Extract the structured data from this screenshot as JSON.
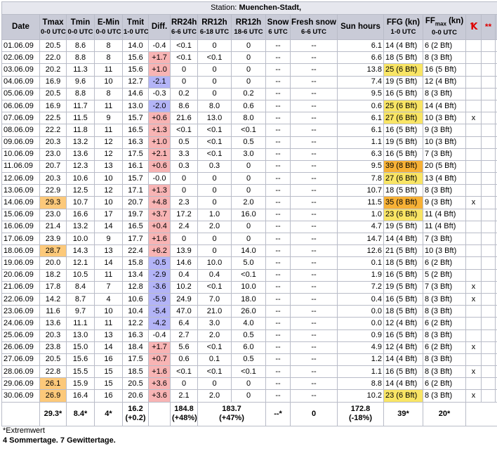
{
  "station_label": "Station:",
  "station_name": "Muenchen-Stadt,",
  "headers": {
    "date": "Date",
    "tmax": "Tmax",
    "tmax_sub": "0-0 UTC",
    "tmin": "Tmin",
    "tmin_sub": "0-0 UTC",
    "emin": "E-Min",
    "emin_sub": "0-0 UTC",
    "tmit": "Tmit",
    "tmit_sub": "1-0 UTC",
    "diff": "Diff.",
    "rr24": "RR24h",
    "rr24_sub": "6-6 UTC",
    "rr12a": "RR12h",
    "rr12a_sub": "6-18 UTC",
    "rr12b": "RR12h",
    "rr12b_sub": "18-6 UTC",
    "snow": "Snow",
    "snow_sub": "6 UTC",
    "fresh": "Fresh snow",
    "fresh_sub": "6-6 UTC",
    "sun": "Sun hours",
    "ffg": "FFG (kn)",
    "ffg_sub": "1-0 UTC",
    "ffmax": "FF",
    "ffmax_subscript": "max",
    "ffmax_unit": " (kn)",
    "ffmax_sub": "0-0 UTC",
    "sym1": "Ꝁ",
    "sym2": "**",
    "sym3": "∾"
  },
  "rows": [
    {
      "date": "01.06.09",
      "tmax": "20.5",
      "tmin": "8.6",
      "emin": "8",
      "tmit": "14.0",
      "diff": "-0.4",
      "rr24": "<0.1",
      "rr12a": "0",
      "rr12b": "0",
      "snow": "--",
      "fresh": "--",
      "sun": "6.1",
      "ffg": "14 (4 Bft)",
      "ffmax": "6 (2 Bft)",
      "x": ""
    },
    {
      "date": "02.06.09",
      "tmax": "22.0",
      "tmin": "8.8",
      "emin": "8",
      "tmit": "15.6",
      "diff": "+1.7",
      "rr24": "<0.1",
      "rr12a": "<0.1",
      "rr12b": "0",
      "snow": "--",
      "fresh": "--",
      "sun": "6.6",
      "ffg": "18 (5 Bft)",
      "ffmax": "8 (3 Bft)",
      "x": ""
    },
    {
      "date": "03.06.09",
      "tmax": "20.2",
      "tmin": "11.3",
      "emin": "11",
      "tmit": "15.6",
      "diff": "+1.0",
      "rr24": "0",
      "rr12a": "0",
      "rr12b": "0",
      "snow": "--",
      "fresh": "--",
      "sun": "13.8",
      "ffg": "25 (6 Bft)",
      "ffmax": "16 (5 Bft)",
      "x": ""
    },
    {
      "date": "04.06.09",
      "tmax": "16.9",
      "tmin": "9.6",
      "emin": "10",
      "tmit": "12.7",
      "diff": "-2.1",
      "rr24": "0",
      "rr12a": "0",
      "rr12b": "0",
      "snow": "--",
      "fresh": "--",
      "sun": "7.4",
      "ffg": "19 (5 Bft)",
      "ffmax": "12 (4 Bft)",
      "x": ""
    },
    {
      "date": "05.06.09",
      "tmax": "20.5",
      "tmin": "8.8",
      "emin": "8",
      "tmit": "14.6",
      "diff": "-0.3",
      "rr24": "0.2",
      "rr12a": "0",
      "rr12b": "0.2",
      "snow": "--",
      "fresh": "--",
      "sun": "9.5",
      "ffg": "16 (5 Bft)",
      "ffmax": "8 (3 Bft)",
      "x": ""
    },
    {
      "date": "06.06.09",
      "tmax": "16.9",
      "tmin": "11.7",
      "emin": "11",
      "tmit": "13.0",
      "diff": "-2.0",
      "rr24": "8.6",
      "rr12a": "8.0",
      "rr12b": "0.6",
      "snow": "--",
      "fresh": "--",
      "sun": "0.6",
      "ffg": "25 (6 Bft)",
      "ffmax": "14 (4 Bft)",
      "x": ""
    },
    {
      "date": "07.06.09",
      "tmax": "22.5",
      "tmin": "11.5",
      "emin": "9",
      "tmit": "15.7",
      "diff": "+0.6",
      "rr24": "21.6",
      "rr12a": "13.0",
      "rr12b": "8.0",
      "snow": "--",
      "fresh": "--",
      "sun": "6.1",
      "ffg": "27 (6 Bft)",
      "ffmax": "10 (3 Bft)",
      "x": "x"
    },
    {
      "date": "08.06.09",
      "tmax": "22.2",
      "tmin": "11.8",
      "emin": "11",
      "tmit": "16.5",
      "diff": "+1.3",
      "rr24": "<0.1",
      "rr12a": "<0.1",
      "rr12b": "<0.1",
      "snow": "--",
      "fresh": "--",
      "sun": "6.1",
      "ffg": "16 (5 Bft)",
      "ffmax": "9 (3 Bft)",
      "x": ""
    },
    {
      "date": "09.06.09",
      "tmax": "20.3",
      "tmin": "13.2",
      "emin": "12",
      "tmit": "16.3",
      "diff": "+1.0",
      "rr24": "0.5",
      "rr12a": "<0.1",
      "rr12b": "0.5",
      "snow": "--",
      "fresh": "--",
      "sun": "1.1",
      "ffg": "19 (5 Bft)",
      "ffmax": "10 (3 Bft)",
      "x": ""
    },
    {
      "date": "10.06.09",
      "tmax": "23.0",
      "tmin": "13.6",
      "emin": "12",
      "tmit": "17.5",
      "diff": "+2.1",
      "rr24": "3.3",
      "rr12a": "<0.1",
      "rr12b": "3.0",
      "snow": "--",
      "fresh": "--",
      "sun": "6.3",
      "ffg": "16 (5 Bft)",
      "ffmax": "7 (3 Bft)",
      "x": ""
    },
    {
      "date": "11.06.09",
      "tmax": "20.7",
      "tmin": "12.3",
      "emin": "13",
      "tmit": "16.1",
      "diff": "+0.6",
      "rr24": "0.3",
      "rr12a": "0.3",
      "rr12b": "0",
      "snow": "--",
      "fresh": "--",
      "sun": "9.5",
      "ffg": "39 (8 Bft)",
      "ffmax": "20 (5 Bft)",
      "x": ""
    },
    {
      "date": "12.06.09",
      "tmax": "20.3",
      "tmin": "10.6",
      "emin": "10",
      "tmit": "15.7",
      "diff": "-0.0",
      "rr24": "0",
      "rr12a": "0",
      "rr12b": "0",
      "snow": "--",
      "fresh": "--",
      "sun": "7.8",
      "ffg": "27 (6 Bft)",
      "ffmax": "13 (4 Bft)",
      "x": ""
    },
    {
      "date": "13.06.09",
      "tmax": "22.9",
      "tmin": "12.5",
      "emin": "12",
      "tmit": "17.1",
      "diff": "+1.3",
      "rr24": "0",
      "rr12a": "0",
      "rr12b": "0",
      "snow": "--",
      "fresh": "--",
      "sun": "10.7",
      "ffg": "18 (5 Bft)",
      "ffmax": "8 (3 Bft)",
      "x": ""
    },
    {
      "date": "14.06.09",
      "tmax": "29.3",
      "tmin": "10.7",
      "emin": "10",
      "tmit": "20.7",
      "diff": "+4.8",
      "rr24": "2.3",
      "rr12a": "0",
      "rr12b": "2.0",
      "snow": "--",
      "fresh": "--",
      "sun": "11.5",
      "ffg": "35 (8 Bft)",
      "ffmax": "9 (3 Bft)",
      "x": "x"
    },
    {
      "date": "15.06.09",
      "tmax": "23.0",
      "tmin": "16.6",
      "emin": "17",
      "tmit": "19.7",
      "diff": "+3.7",
      "rr24": "17.2",
      "rr12a": "1.0",
      "rr12b": "16.0",
      "snow": "--",
      "fresh": "--",
      "sun": "1.0",
      "ffg": "23 (6 Bft)",
      "ffmax": "11 (4 Bft)",
      "x": ""
    },
    {
      "date": "16.06.09",
      "tmax": "21.4",
      "tmin": "13.2",
      "emin": "14",
      "tmit": "16.5",
      "diff": "+0.4",
      "rr24": "2.4",
      "rr12a": "2.0",
      "rr12b": "0",
      "snow": "--",
      "fresh": "--",
      "sun": "4.7",
      "ffg": "19 (5 Bft)",
      "ffmax": "11 (4 Bft)",
      "x": ""
    },
    {
      "date": "17.06.09",
      "tmax": "23.9",
      "tmin": "10.0",
      "emin": "9",
      "tmit": "17.7",
      "diff": "+1.6",
      "rr24": "0",
      "rr12a": "0",
      "rr12b": "0",
      "snow": "--",
      "fresh": "--",
      "sun": "14.7",
      "ffg": "14 (4 Bft)",
      "ffmax": "7 (3 Bft)",
      "x": ""
    },
    {
      "date": "18.06.09",
      "tmax": "28.7",
      "tmin": "14.3",
      "emin": "13",
      "tmit": "22.4",
      "diff": "+6.2",
      "rr24": "13.9",
      "rr12a": "0",
      "rr12b": "14.0",
      "snow": "--",
      "fresh": "--",
      "sun": "12.6",
      "ffg": "21 (5 Bft)",
      "ffmax": "10 (3 Bft)",
      "x": ""
    },
    {
      "date": "19.06.09",
      "tmax": "20.0",
      "tmin": "12.1",
      "emin": "14",
      "tmit": "15.8",
      "diff": "-0.5",
      "rr24": "14.6",
      "rr12a": "10.0",
      "rr12b": "5.0",
      "snow": "--",
      "fresh": "--",
      "sun": "0.1",
      "ffg": "18 (5 Bft)",
      "ffmax": "6 (2 Bft)",
      "x": ""
    },
    {
      "date": "20.06.09",
      "tmax": "18.2",
      "tmin": "10.5",
      "emin": "11",
      "tmit": "13.4",
      "diff": "-2.9",
      "rr24": "0.4",
      "rr12a": "0.4",
      "rr12b": "<0.1",
      "snow": "--",
      "fresh": "--",
      "sun": "1.9",
      "ffg": "16 (5 Bft)",
      "ffmax": "5 (2 Bft)",
      "x": ""
    },
    {
      "date": "21.06.09",
      "tmax": "17.8",
      "tmin": "8.4",
      "emin": "7",
      "tmit": "12.8",
      "diff": "-3.6",
      "rr24": "10.2",
      "rr12a": "<0.1",
      "rr12b": "10.0",
      "snow": "--",
      "fresh": "--",
      "sun": "7.2",
      "ffg": "19 (5 Bft)",
      "ffmax": "7 (3 Bft)",
      "x": "x"
    },
    {
      "date": "22.06.09",
      "tmax": "14.2",
      "tmin": "8.7",
      "emin": "4",
      "tmit": "10.6",
      "diff": "-5.9",
      "rr24": "24.9",
      "rr12a": "7.0",
      "rr12b": "18.0",
      "snow": "--",
      "fresh": "--",
      "sun": "0.4",
      "ffg": "16 (5 Bft)",
      "ffmax": "8 (3 Bft)",
      "x": "x"
    },
    {
      "date": "23.06.09",
      "tmax": "11.6",
      "tmin": "9.7",
      "emin": "10",
      "tmit": "10.4",
      "diff": "-5.4",
      "rr24": "47.0",
      "rr12a": "21.0",
      "rr12b": "26.0",
      "snow": "--",
      "fresh": "--",
      "sun": "0.0",
      "ffg": "18 (5 Bft)",
      "ffmax": "8 (3 Bft)",
      "x": ""
    },
    {
      "date": "24.06.09",
      "tmax": "13.6",
      "tmin": "11.1",
      "emin": "11",
      "tmit": "12.2",
      "diff": "-4.2",
      "rr24": "6.4",
      "rr12a": "3.0",
      "rr12b": "4.0",
      "snow": "--",
      "fresh": "--",
      "sun": "0.0",
      "ffg": "12 (4 Bft)",
      "ffmax": "6 (2 Bft)",
      "x": ""
    },
    {
      "date": "25.06.09",
      "tmax": "20.3",
      "tmin": "13.0",
      "emin": "13",
      "tmit": "16.3",
      "diff": "-0.4",
      "rr24": "2.7",
      "rr12a": "2.0",
      "rr12b": "0.5",
      "snow": "--",
      "fresh": "--",
      "sun": "0.9",
      "ffg": "16 (5 Bft)",
      "ffmax": "8 (3 Bft)",
      "x": ""
    },
    {
      "date": "26.06.09",
      "tmax": "23.8",
      "tmin": "15.0",
      "emin": "14",
      "tmit": "18.4",
      "diff": "+1.7",
      "rr24": "5.6",
      "rr12a": "<0.1",
      "rr12b": "6.0",
      "snow": "--",
      "fresh": "--",
      "sun": "4.9",
      "ffg": "12 (4 Bft)",
      "ffmax": "6 (2 Bft)",
      "x": "x"
    },
    {
      "date": "27.06.09",
      "tmax": "20.5",
      "tmin": "15.6",
      "emin": "16",
      "tmit": "17.5",
      "diff": "+0.7",
      "rr24": "0.6",
      "rr12a": "0.1",
      "rr12b": "0.5",
      "snow": "--",
      "fresh": "--",
      "sun": "1.2",
      "ffg": "14 (4 Bft)",
      "ffmax": "8 (3 Bft)",
      "x": ""
    },
    {
      "date": "28.06.09",
      "tmax": "22.8",
      "tmin": "15.5",
      "emin": "15",
      "tmit": "18.5",
      "diff": "+1.6",
      "rr24": "<0.1",
      "rr12a": "<0.1",
      "rr12b": "<0.1",
      "snow": "--",
      "fresh": "--",
      "sun": "1.1",
      "ffg": "16 (5 Bft)",
      "ffmax": "8 (3 Bft)",
      "x": "x"
    },
    {
      "date": "29.06.09",
      "tmax": "26.1",
      "tmin": "15.9",
      "emin": "15",
      "tmit": "20.5",
      "diff": "+3.6",
      "rr24": "0",
      "rr12a": "0",
      "rr12b": "0",
      "snow": "--",
      "fresh": "--",
      "sun": "8.8",
      "ffg": "14 (4 Bft)",
      "ffmax": "6 (2 Bft)",
      "x": ""
    },
    {
      "date": "30.06.09",
      "tmax": "26.9",
      "tmin": "16.4",
      "emin": "16",
      "tmit": "20.6",
      "diff": "+3.6",
      "rr24": "2.1",
      "rr12a": "2.0",
      "rr12b": "0",
      "snow": "--",
      "fresh": "--",
      "sun": "10.2",
      "ffg": "23 (6 Bft)",
      "ffmax": "8 (3 Bft)",
      "x": "x"
    }
  ],
  "summary": {
    "tmax": "29.3*",
    "tmin": "8.4*",
    "emin": "4*",
    "tmit": "16.2",
    "tmit2": "(+0.2)",
    "rr24": "184.8",
    "rr24b": "(+48%)",
    "rr12": "183.7",
    "rr12b": "(+47%)",
    "snow": "--*",
    "fresh": "0",
    "sun": "172.8",
    "sun2": "(-18%)",
    "ffg": "39*",
    "ffmax": "20*"
  },
  "footnote": "*Extremwert",
  "footer_summary": "4 Sommertage. 7 Gewittertage.",
  "colors": {
    "hot": "#fcc97a",
    "warm_diff": "#f8b4b4",
    "cold_diff": "#b3b4f7",
    "ffg_yellow": "#f9e565",
    "ffg_orange": "#f7b136",
    "header_bg": "#c9cbd7"
  }
}
